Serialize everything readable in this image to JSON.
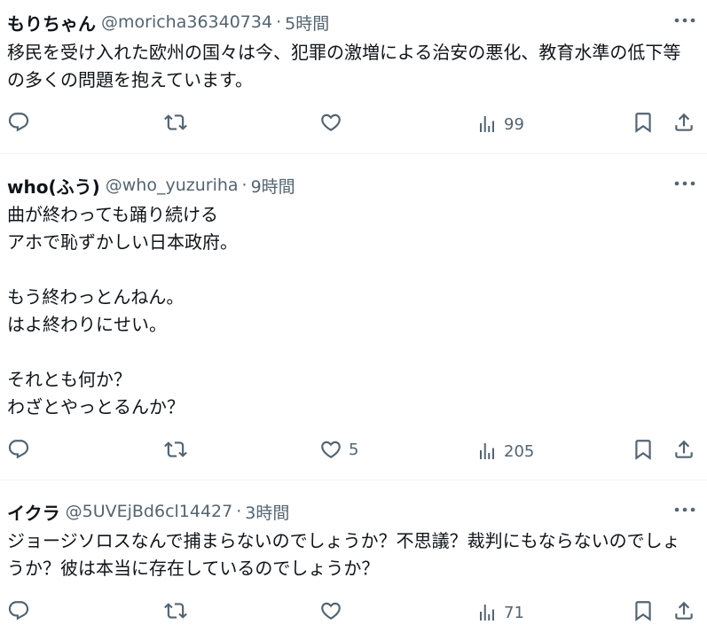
{
  "tweets": [
    {
      "name": "もりちゃん",
      "handle": "@moricha36340734",
      "separator": "·",
      "time": "5時間",
      "text": "移民を受け入れた欧州の国々は今、犯罪の激増による治安の悪化、教育水準の低下等の多くの問題を抱えています。",
      "likes": "",
      "views": "99"
    },
    {
      "name": "who(ふう)",
      "handle": "@who_yuzuriha",
      "separator": "·",
      "time": "9時間",
      "text": "曲が終わっても踊り続ける\nアホで恥ずかしい日本政府。\n\nもう終わっとんねん。\nはよ終わりにせい。\n\nそれとも何か？\nわざとやっとるんか？",
      "likes": "5",
      "views": "205"
    },
    {
      "name": "イクラ",
      "handle": "@5UVEjBd6cl14427",
      "separator": "·",
      "time": "3時間",
      "text": "ジョージソロスなんで捕まらないのでしょうか？不思議？裁判にもならないのでしょうか？彼は本当に存在しているのでしょうか？",
      "likes": "",
      "views": "71"
    }
  ],
  "icons": {
    "more": "more-horizontal-icon",
    "reply": "reply-icon",
    "retweet": "retweet-icon",
    "like": "heart-icon",
    "views": "analytics-icon",
    "bookmark": "bookmark-icon",
    "share": "share-icon"
  },
  "colors": {
    "text_primary": "#0f1419",
    "text_secondary": "#536471",
    "divider": "#eff3f4"
  }
}
